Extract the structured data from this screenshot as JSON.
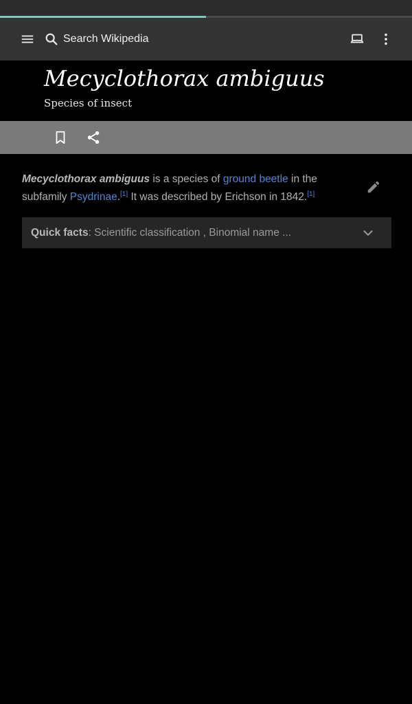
{
  "progress": {
    "fraction": 0.5,
    "color": "#7ec8c0"
  },
  "toolbar": {
    "menu_icon": "menu-icon",
    "search_icon": "search-icon",
    "search_placeholder": "Search Wikipedia",
    "tabs_icon": "tabs-icon",
    "overflow_icon": "more-vert-icon"
  },
  "header": {
    "title": "Mecyclothorax ambiguus",
    "subtitle": "Species of insect"
  },
  "actions": {
    "bookmark_icon": "bookmark-icon",
    "share_icon": "share-icon"
  },
  "article": {
    "lead": {
      "subject": "Mecyclothorax ambiguus",
      "text1": " is a species of ",
      "link1": "ground beetle",
      "text2": " in the subfamily ",
      "link2": "Psydrinae",
      "text3": ".",
      "ref1": "[1]",
      "text4": " It was described by Erichson in 1842.",
      "ref2": "[1]"
    },
    "edit_icon": "pencil-icon",
    "link_color": "#4f86d6"
  },
  "quick_facts": {
    "label": "Quick facts",
    "summary": ": Scientific classification , Binomial name ...",
    "chevron_icon": "chevron-down-icon"
  }
}
